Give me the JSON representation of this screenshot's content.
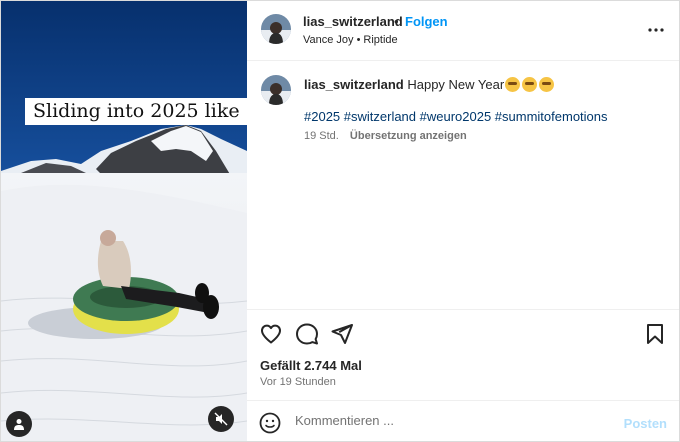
{
  "media": {
    "overlay_text": "Sliding into 2025 like",
    "icons": {
      "user": "user-tag-icon",
      "mute": "speaker-muted-icon"
    }
  },
  "header": {
    "username": "lias_switzerland",
    "separator": "•",
    "follow_label": "Folgen",
    "audio_artist": "Vance Joy",
    "audio_dot": "•",
    "audio_track": "Riptide",
    "more_icon": "more-horizontal-icon"
  },
  "caption": {
    "username": "lias_switzerland",
    "text": "Happy New Year",
    "emoji_icon": "partying-face-emoji",
    "hashtags": "#2025 #switzerland #weuro2025 #summitofemotions",
    "age": "19 Std.",
    "translate_label": "Übersetzung anzeigen"
  },
  "actions": {
    "like_icon": "heart-icon",
    "comment_icon": "comment-bubble-icon",
    "share_icon": "paper-plane-icon",
    "save_icon": "bookmark-icon"
  },
  "stats": {
    "likes": "Gefällt 2.744 Mal",
    "timestamp": "Vor 19 Stunden"
  },
  "comment": {
    "emoji_icon": "smiley-icon",
    "placeholder": "Kommentieren ...",
    "post_label": "Posten"
  },
  "colors": {
    "accent": "#0095f6",
    "hashtag": "#00376b",
    "secondary_text": "#737373",
    "post_disabled": "#b2dffc"
  }
}
